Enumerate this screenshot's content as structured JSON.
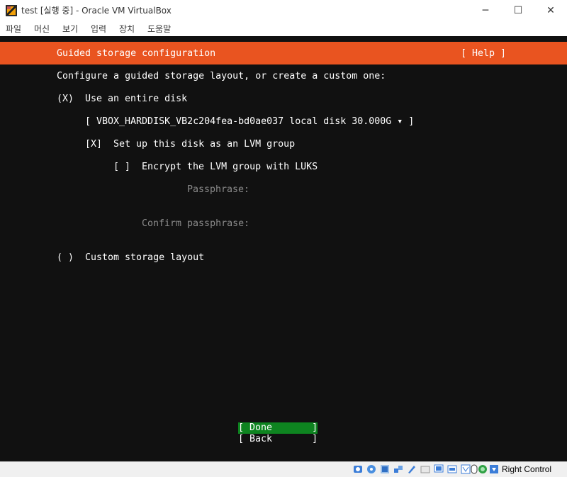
{
  "window": {
    "title": "test [실행 중] - Oracle VM VirtualBox",
    "controls": {
      "minimize": "─",
      "maximize": "☐",
      "close": "✕"
    }
  },
  "menu": [
    "파일",
    "머신",
    "보기",
    "입력",
    "장치",
    "도움말"
  ],
  "installer": {
    "header_title": "Guided storage configuration",
    "help": "[ Help ]",
    "intro": "Configure a guided storage layout, or create a custom one:",
    "entire_disk_radio": "(X)",
    "entire_disk_label": "Use an entire disk",
    "disk_select": "[ VBOX_HARDDISK_VB2c204fea-bd0ae037 local disk 30.000G ▾ ]",
    "lvm_checkbox": "[X]",
    "lvm_label": "Set up this disk as an LVM group",
    "encrypt_checkbox": "[ ]",
    "encrypt_label": "Encrypt the LVM group with LUKS",
    "passphrase_label": "Passphrase:",
    "confirm_label": "Confirm passphrase:",
    "custom_radio": "( )",
    "custom_label": "Custom storage layout",
    "done_button": "[ Done       ]",
    "back_button": "[ Back       ]"
  },
  "statusbar": {
    "host_key": "Right Control",
    "icons": [
      "hard-disk-icon",
      "optical-drive-icon",
      "audio-icon",
      "network-icon",
      "usb-icon",
      "shared-folders-icon",
      "display-icon",
      "video-capture-icon",
      "screen-icon",
      "mouse-integration-icon",
      "cpu-icon",
      "keyboard-icon",
      "arrow-down-icon"
    ]
  },
  "colors": {
    "header_orange": "#e95420",
    "done_green": "#0e8420",
    "screen_bg": "#111111"
  }
}
